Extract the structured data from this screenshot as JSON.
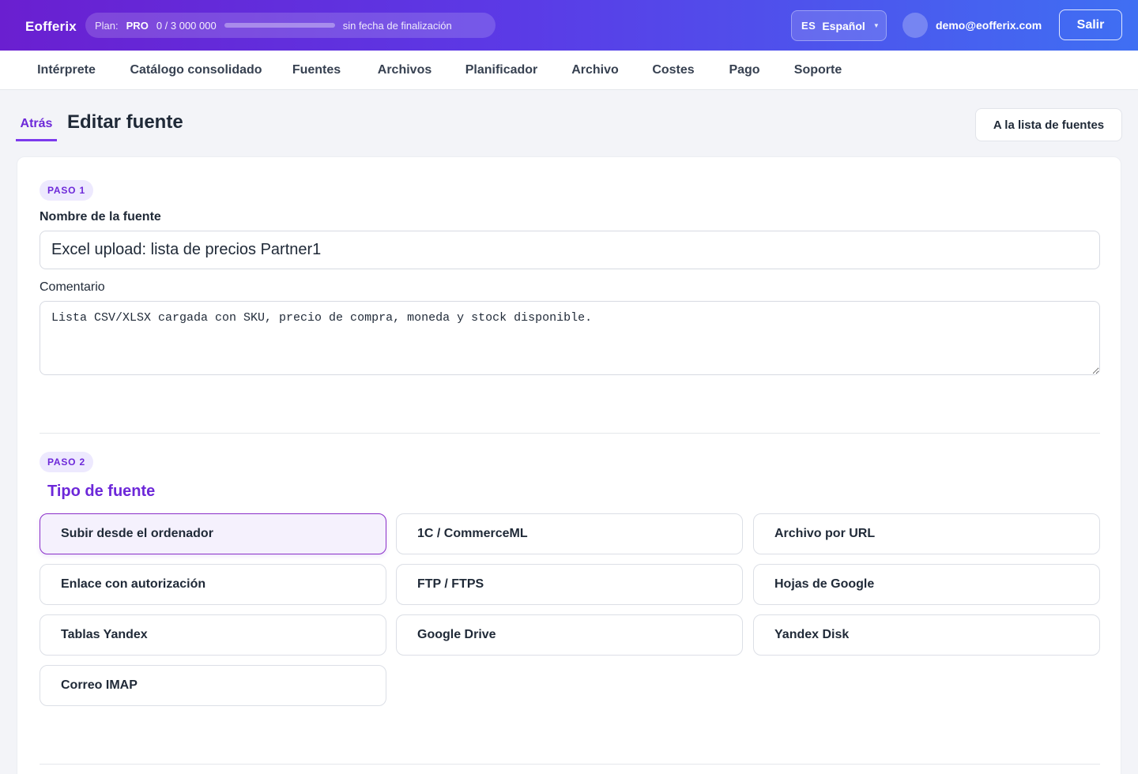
{
  "brand": "Eofferix",
  "plan": {
    "label": "Plan:",
    "name": "PRO",
    "usage": "0 / 3 000 000",
    "usage_fraction": 0,
    "expiry": "sin fecha de finalización"
  },
  "language": {
    "code": "ES",
    "name": "Español"
  },
  "user": {
    "email": "demo@eofferix.com"
  },
  "logout_label": "Salir",
  "nav": [
    {
      "label": "Intérprete",
      "active": false
    },
    {
      "label": "Catálogo consolidado",
      "active": false
    },
    {
      "label": "Fuentes",
      "active": true
    },
    {
      "label": "Archivos",
      "active": false
    },
    {
      "label": "Planificador",
      "active": false
    },
    {
      "label": "Archivo",
      "active": false
    },
    {
      "label": "Costes",
      "active": false
    },
    {
      "label": "Pago",
      "active": false
    },
    {
      "label": "Soporte",
      "active": false
    }
  ],
  "page": {
    "back_label": "Atrás",
    "title": "Editar fuente",
    "to_list_label": "A la lista de fuentes"
  },
  "step1": {
    "badge": "PASO 1",
    "name_label": "Nombre de la fuente",
    "name_value": "Excel upload: lista de precios Partner1",
    "comment_label": "Comentario",
    "comment_value": "Lista CSV/XLSX cargada con SKU, precio de compra, moneda y stock disponible."
  },
  "step2": {
    "badge": "PASO 2",
    "title": "Tipo de fuente",
    "options": [
      {
        "label": "Subir desde el ordenador",
        "selected": true
      },
      {
        "label": "1C / CommerceML",
        "selected": false
      },
      {
        "label": "Archivo por URL",
        "selected": false
      },
      {
        "label": "Enlace con autorización",
        "selected": false
      },
      {
        "label": "FTP / FTPS",
        "selected": false
      },
      {
        "label": "Hojas de Google",
        "selected": false
      },
      {
        "label": "Tablas Yandex",
        "selected": false
      },
      {
        "label": "Google Drive",
        "selected": false
      },
      {
        "label": "Yandex Disk",
        "selected": false
      },
      {
        "label": "Correo IMAP",
        "selected": false
      }
    ]
  }
}
